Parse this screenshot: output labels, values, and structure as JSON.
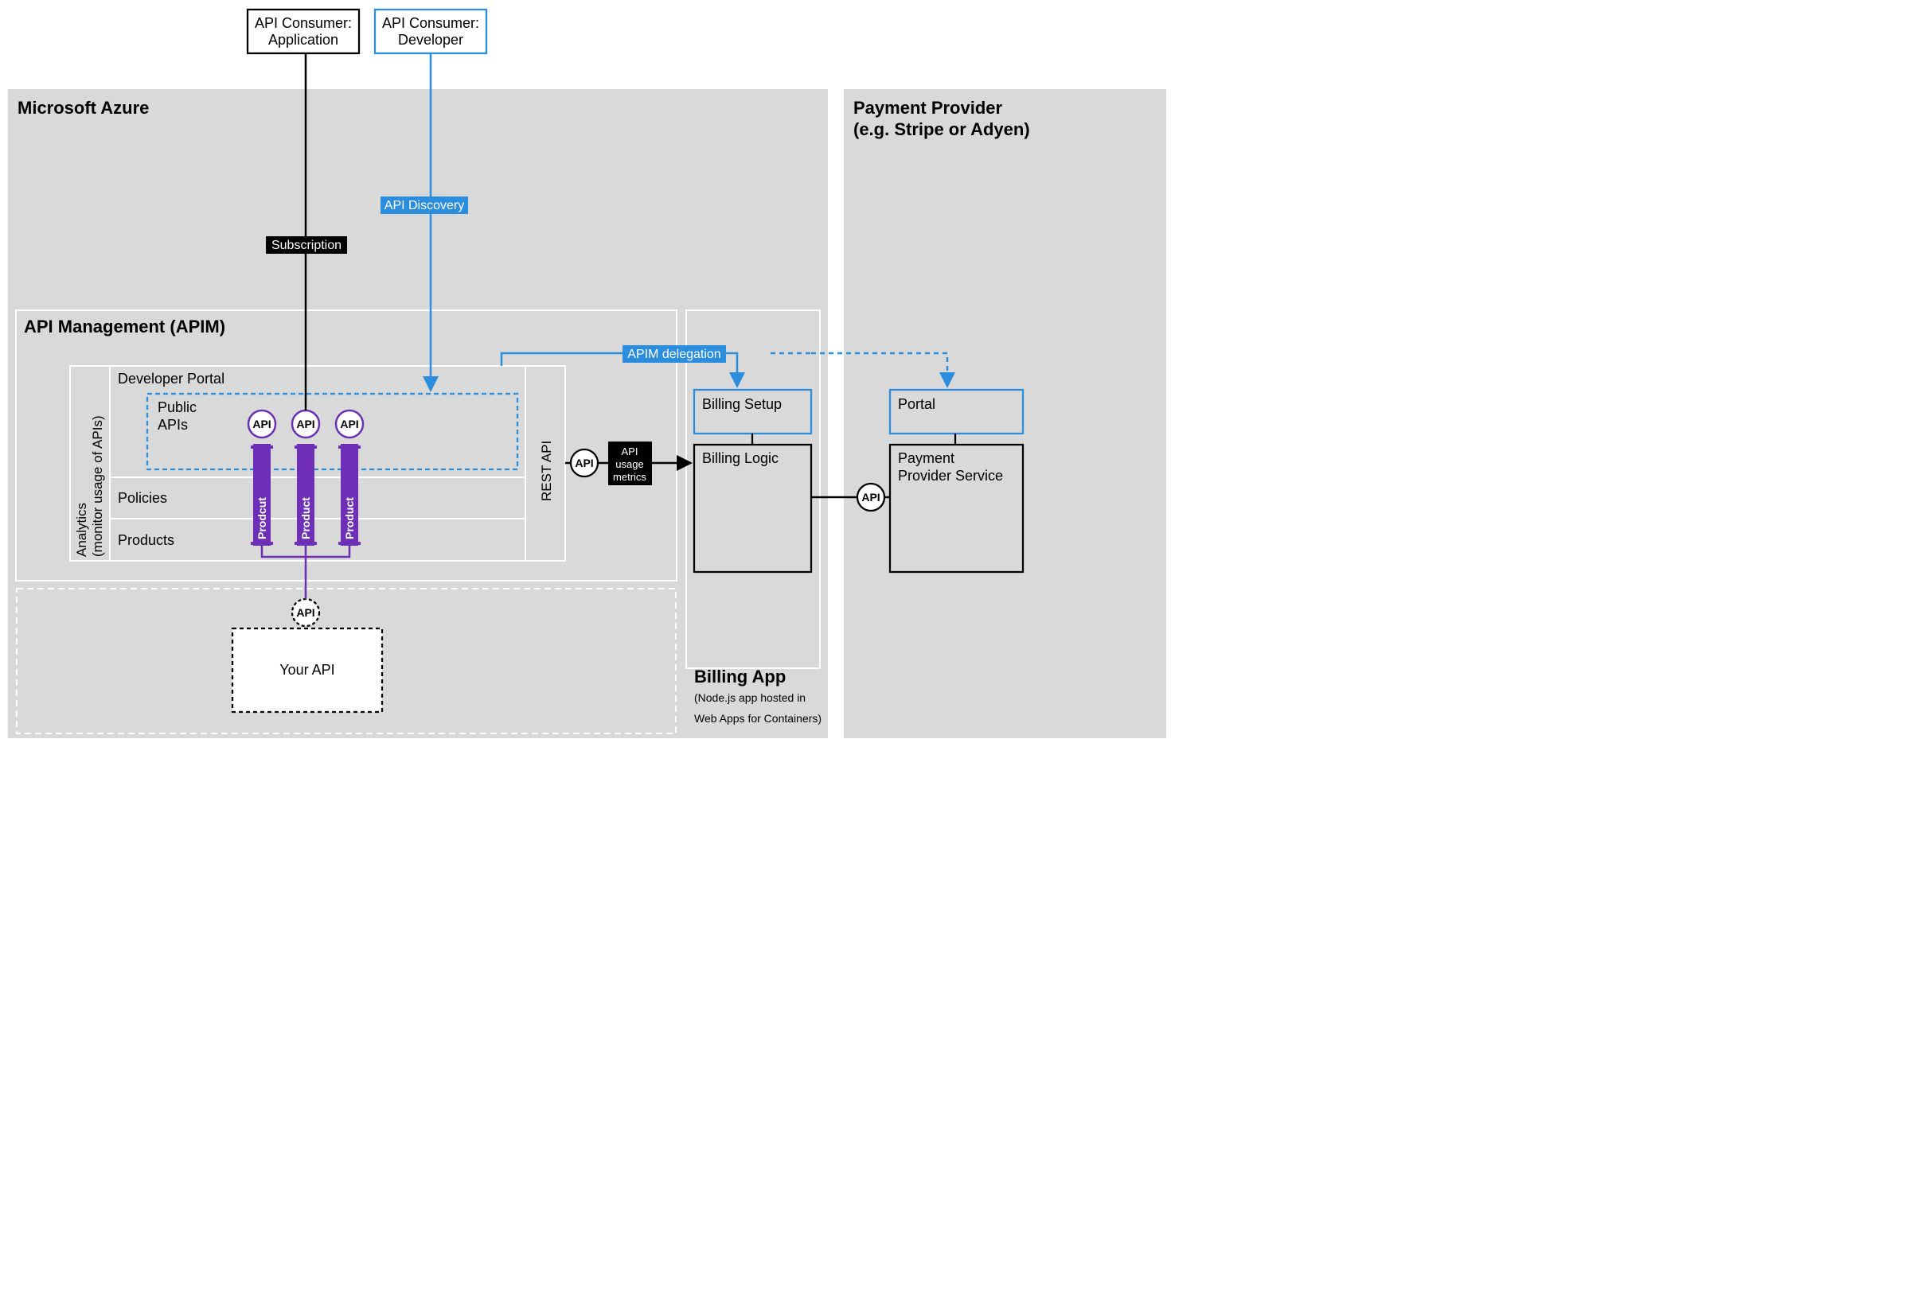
{
  "consumers": {
    "application": {
      "line1": "API Consumer:",
      "line2": "Application"
    },
    "developer": {
      "line1": "API Consumer:",
      "line2": "Developer"
    }
  },
  "regions": {
    "azure": {
      "title": "Microsoft Azure"
    },
    "payment": {
      "title_line1": "Payment Provider",
      "title_line2": "(e.g. Stripe or Adyen)"
    }
  },
  "apim": {
    "title": "API Management (APIM)",
    "analytics_line1": "Analytics",
    "analytics_line2": "(monitor usage of APIs)",
    "rows": {
      "developer_portal": "Developer Portal",
      "public_apis_line1": "Public",
      "public_apis_line2": "APIs",
      "policies": "Policies",
      "products": "Products"
    },
    "rest_api": "REST API",
    "product_pill_1": "Prodcut",
    "product_pill_2": "Product",
    "product_pill_3": "Product"
  },
  "badges": {
    "subscription": "Subscription",
    "api_discovery": "API Discovery",
    "apim_delegation": "APIM delegation",
    "api_usage_line1": "API",
    "api_usage_line2": "usage",
    "api_usage_line3": "metrics"
  },
  "api_node_label": "API",
  "your_api_box": "Your API",
  "billing_app": {
    "title": "Billing App",
    "sub_line1": "(Node.js app hosted in",
    "sub_line2": "Web Apps for Containers)",
    "billing_setup": "Billing Setup",
    "billing_logic": "Billing Logic"
  },
  "payment_provider": {
    "portal": "Portal",
    "service_line1": "Payment",
    "service_line2": "Provider Service"
  },
  "colors": {
    "gray_bg": "#d9d9d9",
    "purple": "#6b2fb3",
    "purple_fill": "#6e2fb6",
    "blue": "#2a8dde",
    "black": "#000000"
  }
}
